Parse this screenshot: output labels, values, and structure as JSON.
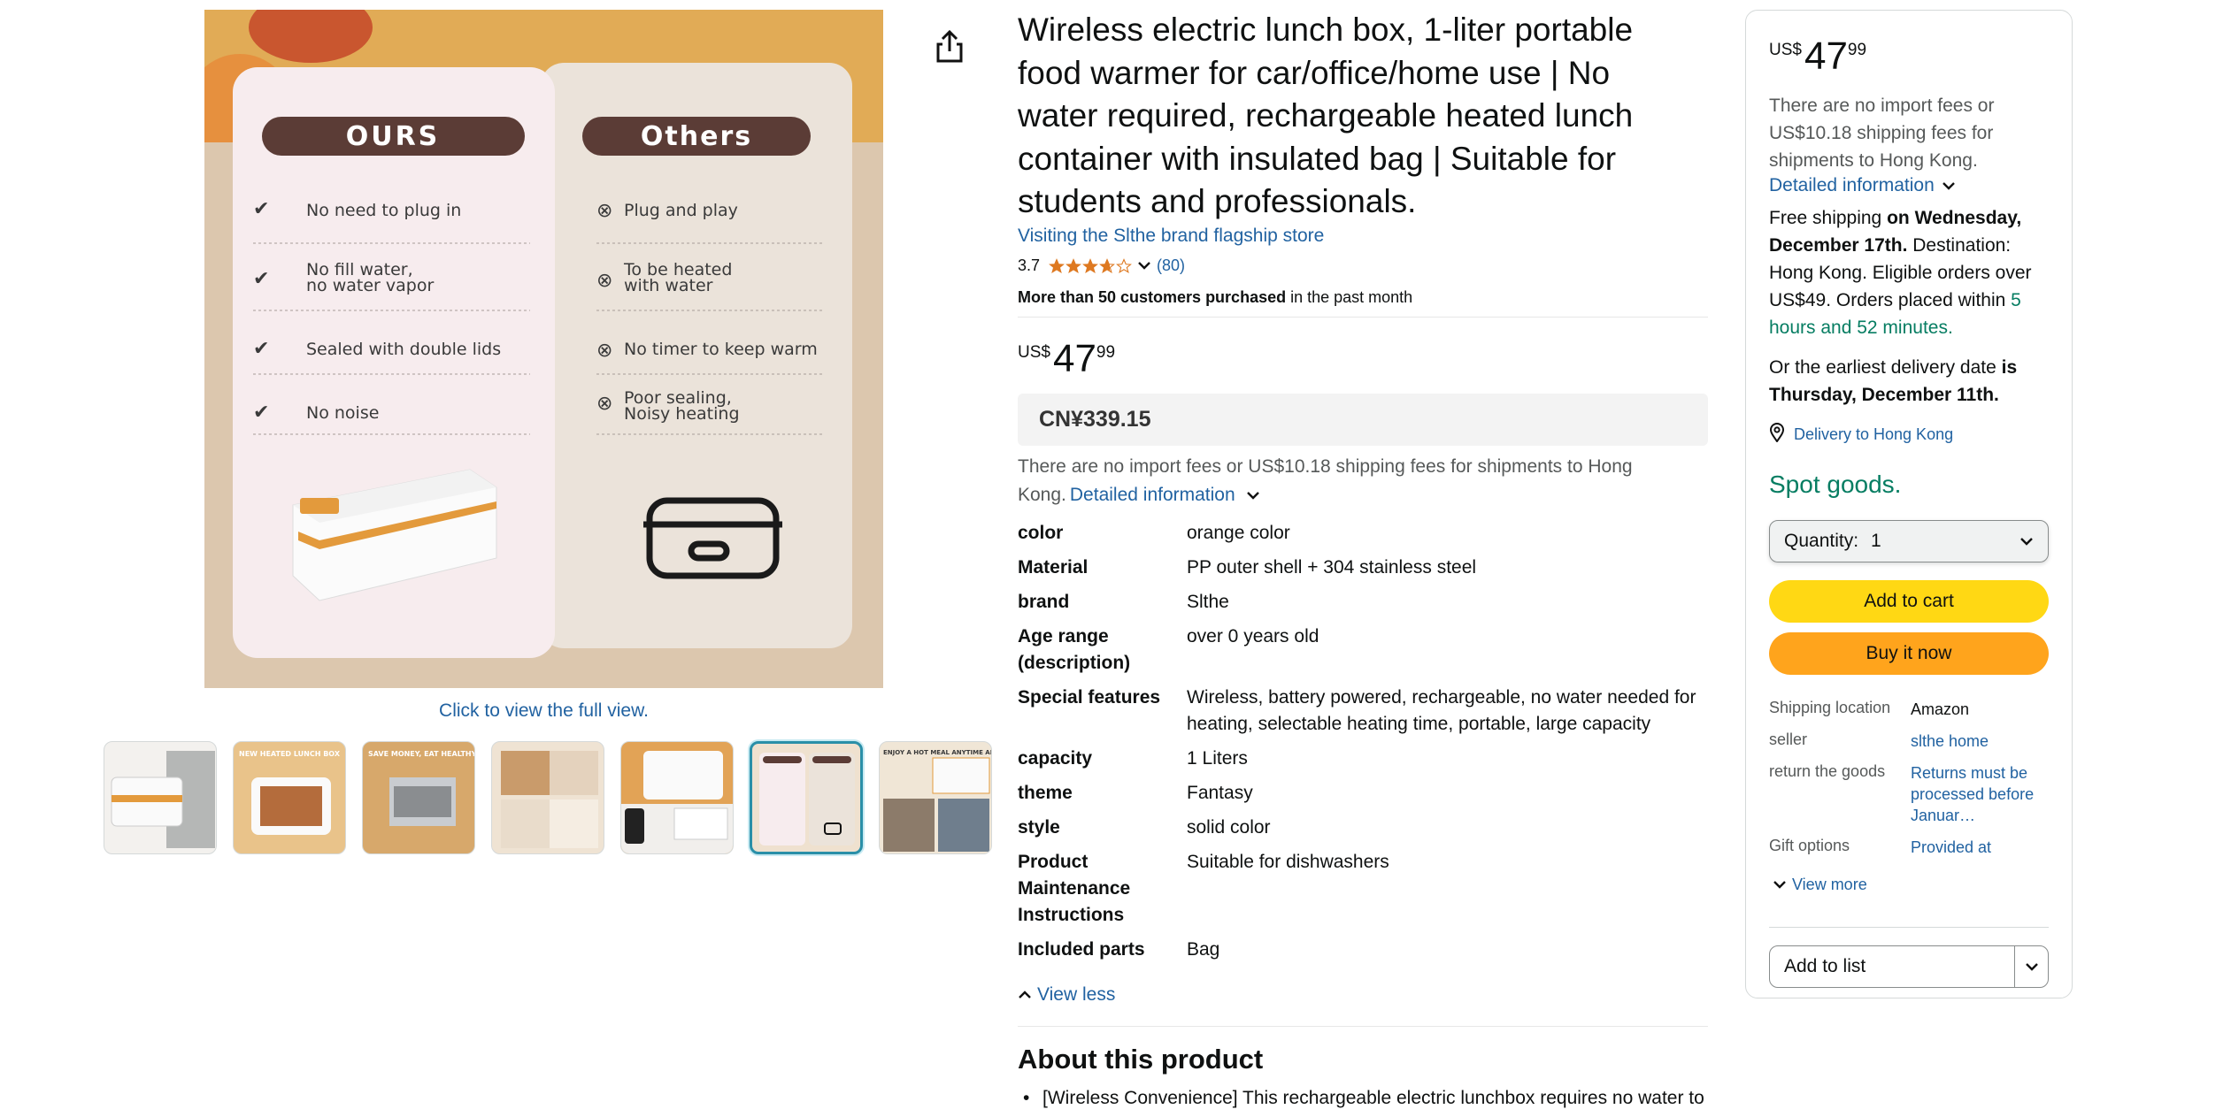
{
  "gallery": {
    "compare_left_label": "OURS",
    "compare_right_label": "Others",
    "ours_items": [
      "No need to plug in",
      "No fill water,\nno water vapor",
      "Sealed with double lids",
      "No noise"
    ],
    "others_items": [
      "Plug and play",
      "To be heated\nwith water",
      "No timer to keep warm",
      "Poor sealing,\nNoisy heating"
    ],
    "click_hint": "Click to view the full view.",
    "thumbnail_captions": [
      "",
      "NEW HEATED LUNCH BOX",
      "SAVE MONEY, EAT HEALTHY",
      "",
      "",
      "",
      "ENJOY A HOT MEAL ANYTIME ANYWHERE"
    ],
    "selected_thumbnail": 6
  },
  "product": {
    "title": "Wireless electric lunch box, 1-liter portable food warmer for car/office/home use | No water required, rechargeable heated lunch container with insulated bag | Suitable for students and professionals.",
    "store_link": "Visiting the Slthe brand flagship store",
    "rating": "3.7",
    "rating_value": 3.7,
    "review_count": "(80)",
    "purchase_bold": "More than 50 customers purchased",
    "purchase_rest": " in the past month",
    "price": {
      "symbol": "US$",
      "whole": "47",
      "fraction": "99"
    },
    "cny_price": "CN¥339.15",
    "import_note": "There are no import fees or US$10.18 shipping fees for shipments to Hong Kong.",
    "detailed_info": "Detailed information",
    "specs": [
      {
        "key": "color",
        "value": "orange color"
      },
      {
        "key": "Material",
        "value": "PP outer shell + 304 stainless steel"
      },
      {
        "key": "brand",
        "value": "Slthe"
      },
      {
        "key": "Age range (description)",
        "value": "over 0 years old"
      },
      {
        "key": "Special features",
        "value": "Wireless, battery powered, rechargeable, no water needed for heating, selectable heating time, portable, large capacity"
      },
      {
        "key": "capacity",
        "value": "1 Liters"
      },
      {
        "key": "theme",
        "value": "Fantasy"
      },
      {
        "key": "style",
        "value": "solid color"
      },
      {
        "key": "Product Maintenance Instructions",
        "value": "Suitable for dishwashers"
      },
      {
        "key": "Included parts",
        "value": "Bag"
      }
    ],
    "view_less": "View less",
    "about_title": "About this product",
    "about_bullet": "[Wireless Convenience] This rechargeable electric lunchbox requires no water to heat food. Its wireless design allows for truly portable dining freedom."
  },
  "buybox": {
    "price": {
      "symbol": "US$",
      "whole": "47",
      "fraction": "99"
    },
    "import_note": "There are no import fees or US$10.18 shipping fees for shipments to Hong Kong.",
    "detailed_info": "Detailed information",
    "shipping_prefix": "Free shipping ",
    "shipping_date": "on Wednesday, December 17th.",
    "shipping_mid": " Destination: Hong Kong. Eligible orders over US$49. Orders placed within ",
    "shipping_countdown": "5 hours and 52 minutes.",
    "earliest_prefix": "Or the earliest delivery date ",
    "earliest_bold": "is Thursday, December 11th.",
    "deliver_to": "Delivery to Hong Kong",
    "stock": "Spot goods.",
    "quantity_label": "Quantity:",
    "quantity_value": "1",
    "add_to_cart": "Add to cart",
    "buy_now": "Buy it now",
    "rows": [
      {
        "key": "Shipping location",
        "value": "Amazon"
      },
      {
        "key": "seller",
        "value": "slthe home"
      },
      {
        "key": "return the goods",
        "value": "Returns must be processed before Januar…"
      },
      {
        "key": "Gift options",
        "value": "Provided at"
      }
    ],
    "view_more": "View more",
    "add_to_list": "Add to list"
  },
  "colors": {
    "link": "#2162a1",
    "in_stock": "#067d62",
    "star": "#de7921",
    "cart_button": "#ffd814",
    "buy_button": "#ffa41c"
  }
}
